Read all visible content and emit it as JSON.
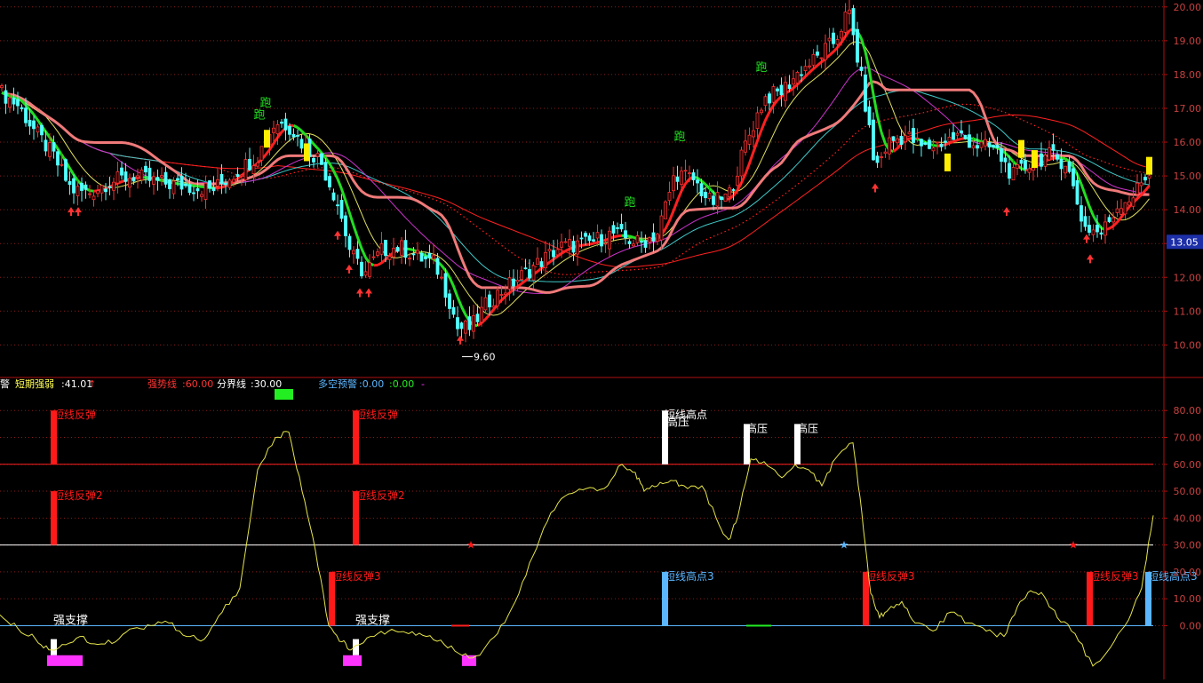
{
  "colors": {
    "background": "#000000",
    "grid": "#8b1a1a",
    "price_up": "#ff3333",
    "price_down": "#54ffff",
    "ma_green": "#22dd22",
    "ma_red": "#ff2020",
    "ma_pink": "#f07a7a",
    "ma_cyan": "#40c8c8",
    "ma_magenta": "#cc33cc",
    "ma_yellow": "#e0e060",
    "oscillator": "#e6e64a",
    "signal_red": "#ff1a1a",
    "signal_white": "#ffffff",
    "signal_blue": "#5bb6ff",
    "signal_magenta": "#ff33ff",
    "signal_green": "#22ee22",
    "current_price_box": "#1d2fa8"
  },
  "chart_data": [
    {
      "type": "candlestick",
      "panel": "main",
      "ylim": [
        9.3,
        20.1
      ],
      "yticks": [
        "20.00",
        "19.00",
        "18.00",
        "17.00",
        "16.00",
        "15.00",
        "14.00",
        "13.00",
        "12.00",
        "11.00",
        "10.00"
      ],
      "current_price": "13.05",
      "low_annotation": "9.60",
      "close_path": [
        [
          0,
          17.5
        ],
        [
          20,
          17.1
        ],
        [
          40,
          16.3
        ],
        [
          60,
          15.6
        ],
        [
          80,
          14.6
        ],
        [
          100,
          14.5
        ],
        [
          120,
          14.8
        ],
        [
          150,
          15.0
        ],
        [
          180,
          14.8
        ],
        [
          210,
          14.7
        ],
        [
          240,
          14.6
        ],
        [
          270,
          15.2
        ],
        [
          290,
          15.6
        ],
        [
          310,
          16.6
        ],
        [
          325,
          16.5
        ],
        [
          345,
          15.8
        ],
        [
          360,
          15.5
        ],
        [
          380,
          14.2
        ],
        [
          395,
          12.7
        ],
        [
          410,
          12.1
        ],
        [
          430,
          12.8
        ],
        [
          450,
          12.9
        ],
        [
          470,
          12.6
        ],
        [
          490,
          12.4
        ],
        [
          505,
          11.4
        ],
        [
          515,
          10.5
        ],
        [
          530,
          10.5
        ],
        [
          550,
          11.3
        ],
        [
          570,
          11.7
        ],
        [
          600,
          12.3
        ],
        [
          630,
          12.9
        ],
        [
          660,
          13.0
        ],
        [
          690,
          13.3
        ],
        [
          720,
          13.0
        ],
        [
          740,
          13.3
        ],
        [
          760,
          15.1
        ],
        [
          780,
          14.9
        ],
        [
          800,
          14.2
        ],
        [
          820,
          14.4
        ],
        [
          840,
          16.0
        ],
        [
          860,
          17.3
        ],
        [
          880,
          17.5
        ],
        [
          900,
          18.1
        ],
        [
          920,
          18.5
        ],
        [
          940,
          19.0
        ],
        [
          955,
          19.9
        ],
        [
          970,
          17.8
        ],
        [
          985,
          15.2
        ],
        [
          1000,
          16.0
        ],
        [
          1020,
          16.2
        ],
        [
          1040,
          15.8
        ],
        [
          1060,
          16.0
        ],
        [
          1080,
          16.2
        ],
        [
          1100,
          15.9
        ],
        [
          1120,
          15.8
        ],
        [
          1140,
          15.0
        ],
        [
          1160,
          15.4
        ],
        [
          1180,
          15.6
        ],
        [
          1200,
          15.4
        ],
        [
          1220,
          13.5
        ],
        [
          1240,
          13.3
        ],
        [
          1260,
          14.2
        ],
        [
          1275,
          14.4
        ],
        [
          1295,
          15.2
        ]
      ],
      "signal_labels": [
        "跑",
        "跑",
        "跑",
        "跑",
        "跑"
      ]
    },
    {
      "type": "line",
      "panel": "indicator",
      "ylim": [
        -20,
        88
      ],
      "yticks": [
        "80.00",
        "70.00",
        "60.00",
        "50.00",
        "40.00",
        "30.00",
        "20.00",
        "10.00",
        "0.00"
      ],
      "reference_lines": [
        60,
        30,
        0
      ],
      "header": {
        "prefix": "警",
        "short_label": "短期强弱",
        "short_value": ":41.01",
        "strong_label": "强势线",
        "strong_value": ":60.00",
        "divider_label": "分界线",
        "divider_value": ":30.00",
        "warn_label": "多空预警",
        "warn_value_1": ":0.00",
        "warn_value_2": ":0.00",
        "tail": "-"
      },
      "series": [
        {
          "values": [
            [
              0,
              4
            ],
            [
              20,
              -1
            ],
            [
              40,
              -5
            ],
            [
              55,
              -9
            ],
            [
              70,
              -7
            ],
            [
              90,
              -4
            ],
            [
              110,
              -7
            ],
            [
              130,
              -6
            ],
            [
              150,
              -1
            ],
            [
              170,
              0
            ],
            [
              190,
              1
            ],
            [
              210,
              -4
            ],
            [
              230,
              -5
            ],
            [
              250,
              5
            ],
            [
              270,
              14
            ],
            [
              290,
              58
            ],
            [
              310,
              70
            ],
            [
              325,
              72
            ],
            [
              340,
              50
            ],
            [
              355,
              28
            ],
            [
              370,
              0
            ],
            [
              385,
              -6
            ],
            [
              395,
              -9
            ],
            [
              405,
              -7
            ],
            [
              425,
              -3
            ],
            [
              445,
              -2
            ],
            [
              460,
              -3
            ],
            [
              480,
              -4
            ],
            [
              500,
              -7
            ],
            [
              520,
              -11
            ],
            [
              540,
              -11
            ],
            [
              560,
              -3
            ],
            [
              580,
              9
            ],
            [
              600,
              26
            ],
            [
              620,
              42
            ],
            [
              640,
              49
            ],
            [
              660,
              51
            ],
            [
              680,
              51
            ],
            [
              700,
              60
            ],
            [
              715,
              57
            ],
            [
              725,
              50
            ],
            [
              740,
              52
            ],
            [
              755,
              54
            ],
            [
              770,
              52
            ],
            [
              790,
              52
            ],
            [
              810,
              37
            ],
            [
              820,
              32
            ],
            [
              830,
              40
            ],
            [
              845,
              62
            ],
            [
              860,
              61
            ],
            [
              880,
              55
            ],
            [
              895,
              60
            ],
            [
              910,
              58
            ],
            [
              925,
              52
            ],
            [
              940,
              62
            ],
            [
              960,
              68
            ],
            [
              970,
              42
            ],
            [
              980,
              12
            ],
            [
              990,
              3
            ],
            [
              1000,
              6
            ],
            [
              1015,
              9
            ],
            [
              1030,
              1
            ],
            [
              1050,
              -2
            ],
            [
              1070,
              5
            ],
            [
              1090,
              1
            ],
            [
              1110,
              -2
            ],
            [
              1130,
              -4
            ],
            [
              1145,
              7
            ],
            [
              1160,
              13
            ],
            [
              1175,
              11
            ],
            [
              1190,
              3
            ],
            [
              1210,
              -3
            ],
            [
              1230,
              -15
            ],
            [
              1250,
              -8
            ],
            [
              1270,
              2
            ],
            [
              1285,
              14
            ],
            [
              1298,
              41
            ]
          ]
        }
      ],
      "markers": [
        {
          "x": 60,
          "value": 80,
          "kind": "bar",
          "color": "red",
          "label": "短线反弹"
        },
        {
          "x": 60,
          "value": 50,
          "kind": "bar",
          "color": "red",
          "label": "短线反弹2"
        },
        {
          "x": 400,
          "value": 80,
          "kind": "bar",
          "color": "red",
          "label": "短线反弹"
        },
        {
          "x": 400,
          "value": 50,
          "kind": "bar",
          "color": "red",
          "label": "短线反弹2"
        },
        {
          "x": 373,
          "value": 20,
          "kind": "bar",
          "color": "red",
          "label": "短线反弹3"
        },
        {
          "x": 748,
          "value": 80,
          "kind": "bar",
          "color": "white",
          "label": "短线高点"
        },
        {
          "x": 748,
          "value": 75,
          "kind": "label",
          "color": "white",
          "label": "高压"
        },
        {
          "x": 840,
          "value": 75,
          "kind": "bar",
          "color": "white",
          "label": "高压"
        },
        {
          "x": 897,
          "value": 75,
          "kind": "bar",
          "color": "white",
          "label": "高压"
        },
        {
          "x": 748,
          "value": 20,
          "kind": "bar",
          "color": "blue",
          "label": "短线高点3"
        },
        {
          "x": 974,
          "value": 20,
          "kind": "bar",
          "color": "red",
          "label": "短线反弹3"
        },
        {
          "x": 1226,
          "value": 20,
          "kind": "bar",
          "color": "red",
          "label": "短线反弹3"
        },
        {
          "x": 1292,
          "value": 20,
          "kind": "bar",
          "color": "blue",
          "label": "短线高点3"
        },
        {
          "x": 60,
          "value": 0,
          "kind": "label",
          "color": "white",
          "label": "强支撑"
        },
        {
          "x": 400,
          "value": 0,
          "kind": "label",
          "color": "white",
          "label": "强支撑"
        }
      ]
    }
  ]
}
